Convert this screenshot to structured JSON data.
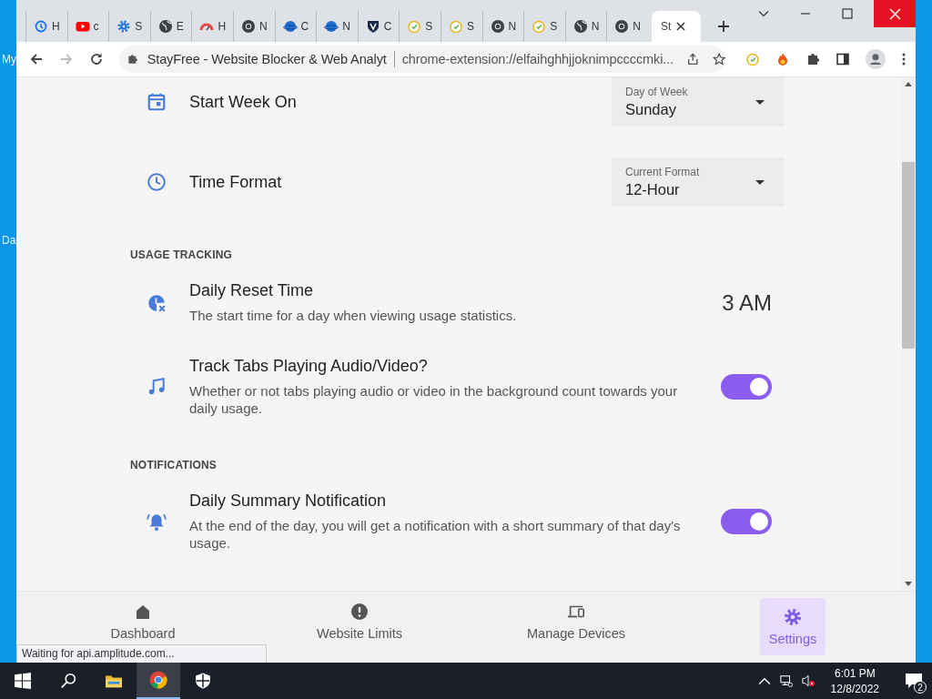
{
  "desktop": {
    "labels": [
      "My",
      "Da"
    ]
  },
  "tabs": [
    {
      "kind": "history",
      "label": "H",
      "selected": false
    },
    {
      "kind": "youtube",
      "label": "c",
      "selected": false
    },
    {
      "kind": "gear",
      "label": "S",
      "selected": false
    },
    {
      "kind": "globe",
      "label": "E",
      "selected": false
    },
    {
      "kind": "gauge",
      "label": "H",
      "selected": false
    },
    {
      "kind": "chrome",
      "label": "N",
      "selected": false
    },
    {
      "kind": "planet",
      "label": "C",
      "selected": false
    },
    {
      "kind": "planet",
      "label": "N",
      "selected": false
    },
    {
      "kind": "shield",
      "label": "C",
      "selected": false
    },
    {
      "kind": "stopwatch",
      "label": "S",
      "selected": false
    },
    {
      "kind": "stopwatch",
      "label": "S",
      "selected": false
    },
    {
      "kind": "chrome",
      "label": "N",
      "selected": false
    },
    {
      "kind": "stopwatch",
      "label": "S",
      "selected": false
    },
    {
      "kind": "globe",
      "label": "N",
      "selected": false
    },
    {
      "kind": "chrome",
      "label": "N",
      "selected": false
    },
    {
      "kind": "none",
      "label": "St",
      "selected": true
    }
  ],
  "address": {
    "site_title": "StayFree - Website Blocker & Web Analyt",
    "url": "chrome-extension://elfaihghhjjoknimpccccmki..."
  },
  "settings": [
    {
      "kind": "select",
      "title": "Start Week On",
      "select_label": "Day of Week",
      "value": "Sunday"
    },
    {
      "kind": "select",
      "title": "Time Format",
      "select_label": "Current Format",
      "value": "12-Hour"
    },
    {
      "kind": "heading",
      "title": "USAGE TRACKING"
    },
    {
      "kind": "value",
      "title": "Daily Reset Time",
      "description": "The start time for a day when viewing usage statistics.",
      "value": "3 AM"
    },
    {
      "kind": "toggle",
      "title": "Track Tabs Playing Audio/Video?",
      "description": "Whether or not tabs playing audio or video in the background count towards your daily usage.",
      "on": true
    },
    {
      "kind": "heading",
      "title": "NOTIFICATIONS"
    },
    {
      "kind": "toggle",
      "title": "Daily Summary Notification",
      "description": "At the end of the day, you will get a notification with a short summary of that day's usage.",
      "on": true
    }
  ],
  "nav": [
    {
      "label": "Dashboard",
      "selected": false
    },
    {
      "label": "Website Limits",
      "selected": false
    },
    {
      "label": "Manage Devices",
      "selected": false
    },
    {
      "label": "Settings",
      "selected": true
    }
  ],
  "status_bar": "Waiting for api.amplitude.com...",
  "taskbar": {
    "time": "6:01 PM",
    "date": "12/8/2022",
    "notifications": "2"
  }
}
